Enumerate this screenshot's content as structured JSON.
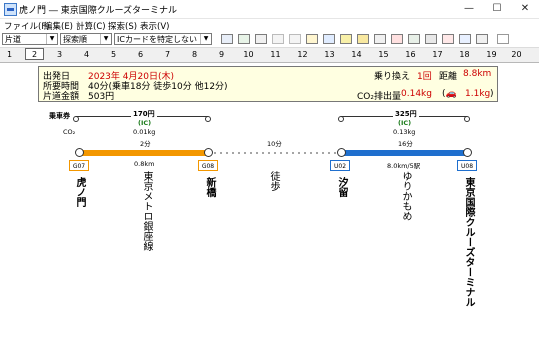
{
  "window": {
    "title": "虎ノ門 ― 東京国際クルーズターミナル",
    "min": "—",
    "max": "☐",
    "close": "✕"
  },
  "menu": [
    "ファイル(F)",
    "編集(E)",
    "計算(C)",
    "探索(S)",
    "表示(V)"
  ],
  "toolbar": {
    "combo1": "片道",
    "combo2": "探索順",
    "combo3": "ICカードを特定しない"
  },
  "tabs": [
    "1",
    "2",
    "3",
    "4",
    "5",
    "6",
    "7",
    "8",
    "9",
    "10",
    "11",
    "12",
    "13",
    "14",
    "15",
    "16",
    "17",
    "18",
    "19",
    "20"
  ],
  "active_tab": "2",
  "summary": {
    "depart_label": "出発日",
    "depart_value": "2023年 4月20日(木)",
    "time_label": "所要時間",
    "time_value": "40分(乗車18分 徒歩10分 他12分)",
    "fare_label": "片道金額",
    "fare_value": "503円",
    "transfer_label": "乗り換え",
    "transfer_value": "1回",
    "distance_label": "距離",
    "distance_value": "8.8km",
    "co2_label": "CO₂排出量",
    "co2_value": "0.14kg",
    "car_value": "1.1kg"
  },
  "route": {
    "ticket_label": "乗車券",
    "co2_label": "CO₂",
    "fare1": "170円",
    "fare1_ic": "(IC)",
    "fare1_co2": "0.01kg",
    "fare1_time": "2分",
    "fare2": "325円",
    "fare2_ic": "(IC)",
    "fare2_co2": "0.13kg",
    "fare2_time": "16分",
    "walk_time": "10分",
    "seg1_dist": "0.8km",
    "seg2_dist": "8.0km/5駅",
    "codes": [
      "G07",
      "G08",
      "U02",
      "U08"
    ],
    "stations": [
      "虎ノ門",
      "新橋",
      "汐留",
      "東京国際クルーズターミナル"
    ],
    "lines": [
      "東京メトロ銀座線",
      "徒歩",
      "ゆりかもめ"
    ],
    "colors": {
      "ginza": "#f39700",
      "yurikamome": "#1f6fce",
      "walk": "#888888"
    }
  }
}
